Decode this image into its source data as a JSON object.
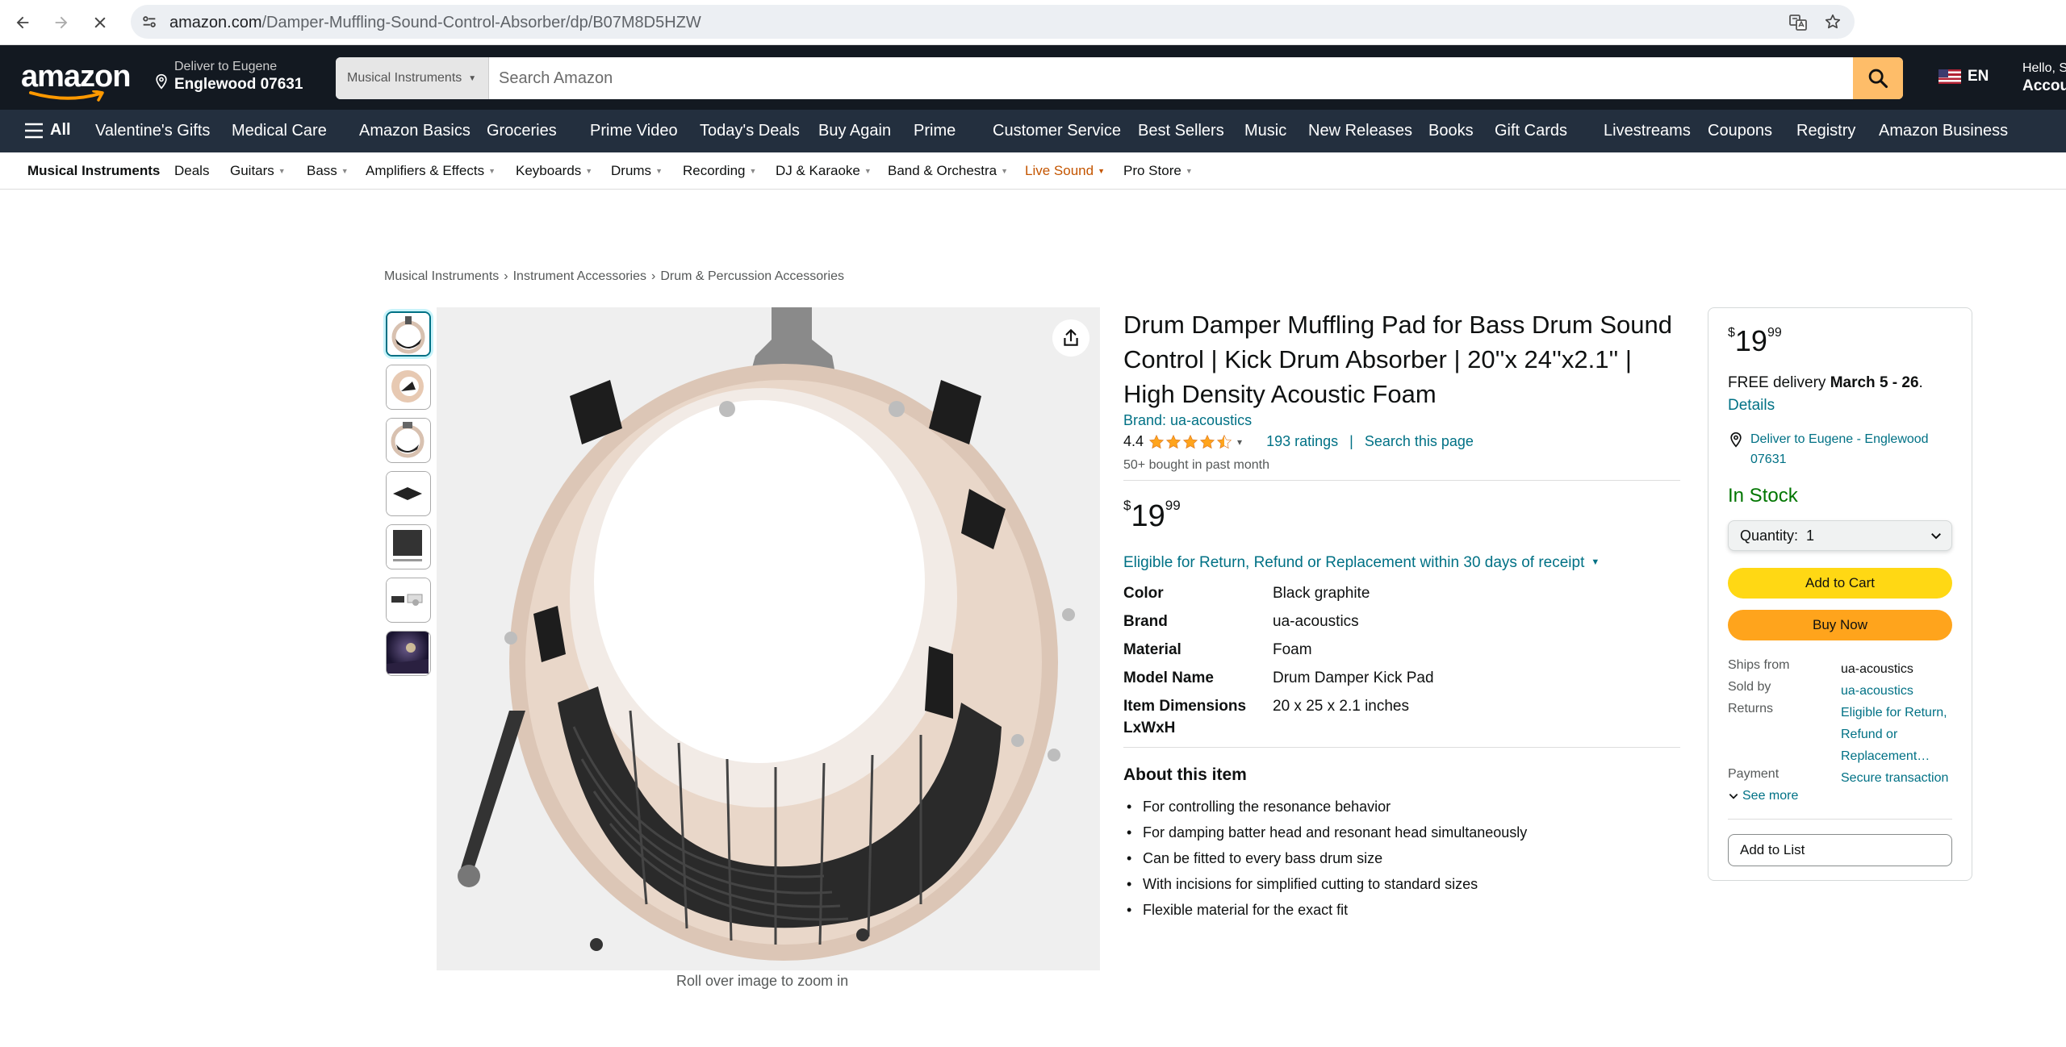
{
  "browser": {
    "url_domain": "amazon.com",
    "url_path": "/Damper-Muffling-Sound-Control-Absorber/dp/B07M8D5HZW"
  },
  "header": {
    "logo_text": "amazon",
    "deliver_line1": "Deliver to Eugene",
    "deliver_line2": "Englewood 07631",
    "search_category": "Musical Instruments",
    "search_placeholder": "Search Amazon",
    "language": "EN",
    "account_line1": "Hello, S",
    "account_line2": "Accou"
  },
  "nav": {
    "all_label": "All",
    "items": [
      "Valentine's Gifts",
      "Medical Care",
      "Amazon Basics",
      "Groceries",
      "Prime Video",
      "Today's Deals",
      "Buy Again",
      "Prime",
      "Customer Service",
      "Best Sellers",
      "Music",
      "New Releases",
      "Books",
      "Gift Cards",
      "Livestreams",
      "Coupons",
      "Registry",
      "Amazon Business"
    ]
  },
  "subnav": {
    "items": [
      "Musical Instruments",
      "Deals",
      "Guitars",
      "Bass",
      "Amplifiers & Effects",
      "Keyboards",
      "Drums",
      "Recording",
      "DJ & Karaoke",
      "Band & Orchestra",
      "Live Sound",
      "Pro Store"
    ]
  },
  "breadcrumb": [
    "Musical Instruments",
    "Instrument Accessories",
    "Drum & Percussion Accessories"
  ],
  "breadcrumb_sep": "›",
  "product": {
    "title": "Drum Damper Muffling Pad for Bass Drum Sound Control | Kick Drum Absorber | 20''x 24''x2.1'' | High Density Acoustic Foam",
    "brand_link": "Brand: ua-acoustics",
    "rating_value": "4.4",
    "rating_count": "193 ratings",
    "rating_bar": "|",
    "search_page": "Search this page",
    "bought": "50+ bought in past month",
    "price_symbol": "$",
    "price_whole": "19",
    "price_fraction": "99",
    "returns": "Eligible for Return, Refund or Replacement within 30 days of receipt",
    "specs": [
      {
        "key": "Color",
        "value": "Black graphite"
      },
      {
        "key": "Brand",
        "value": "ua-acoustics"
      },
      {
        "key": "Material",
        "value": "Foam"
      },
      {
        "key": "Model Name",
        "value": "Drum Damper Kick Pad"
      },
      {
        "key": "Item Dimensions LxWxH",
        "value": "20 x 25 x 2.1 inches"
      }
    ],
    "about_heading": "About this item",
    "bullets": [
      "For controlling the resonance behavior",
      "For damping batter head and resonant head simultaneously",
      "Can be fitted to every bass drum size",
      "With incisions for simplified cutting to standard sizes",
      "Flexible material for the exact fit"
    ],
    "zoom_hint": "Roll over image to zoom in"
  },
  "buybox": {
    "delivery_prefix": "FREE delivery ",
    "delivery_date": "March 5 - 26",
    "delivery_suffix": ".",
    "details": "Details",
    "location": "Deliver to Eugene - Englewood 07631",
    "stock": "In Stock",
    "quantity": "Quantity:  1",
    "add_to_cart": "Add to Cart",
    "buy_now": "Buy Now",
    "ships_from_label": "Ships from",
    "ships_from": "ua-acoustics",
    "sold_by_label": "Sold by",
    "sold_by": "ua-acoustics",
    "returns_label": "Returns",
    "returns": "Eligible for Return, Refund or Replacement…",
    "payment_label": "Payment",
    "payment": "Secure transaction",
    "see_more": "See more",
    "add_to_list": "Add to List"
  },
  "colors": {
    "header_bg": "#131921",
    "nav_bg": "#232f3e",
    "link": "#007185",
    "in_stock": "#007600",
    "cart_button": "#ffd814",
    "buy_button": "#ffa41c",
    "search_button": "#febd69",
    "star": "#ffa41c"
  }
}
